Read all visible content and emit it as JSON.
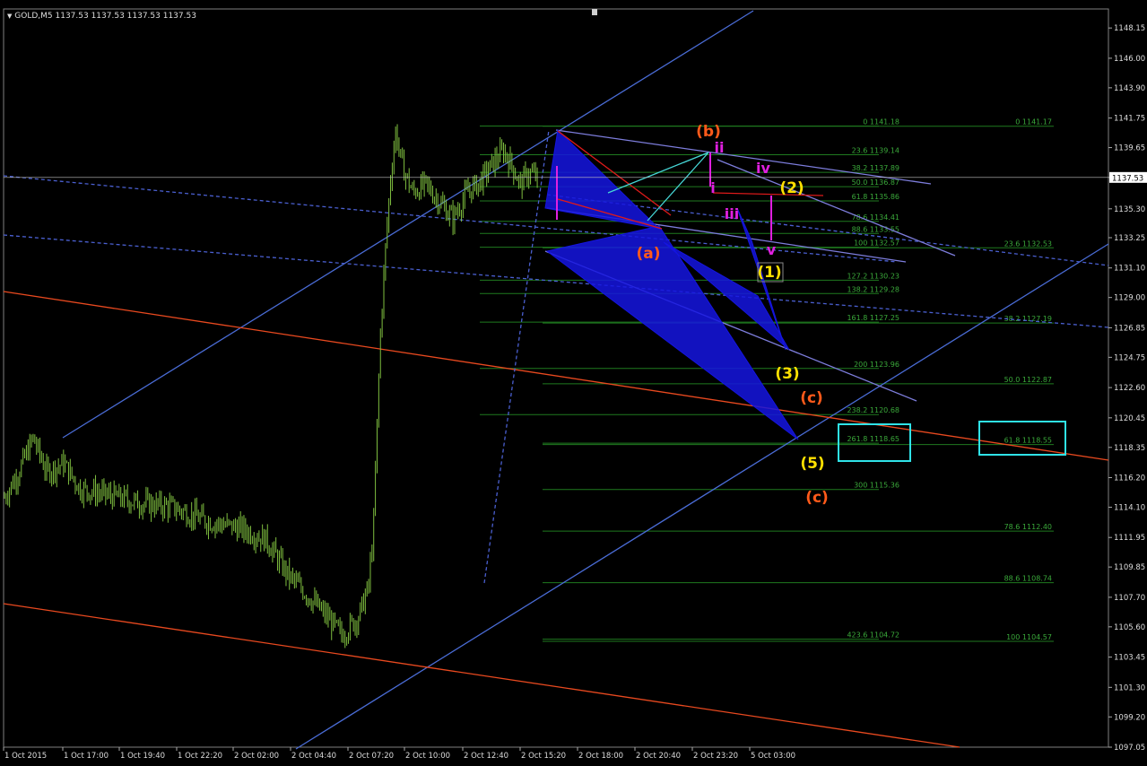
{
  "header": {
    "symbol_label": "GOLD,M5",
    "ohlc": "1137.53 1137.53 1137.53 1137.53",
    "current_price": "1137.53"
  },
  "colors": {
    "background": "#000000",
    "candles": "#7fbf3f",
    "blue_channel": "#4a6cd6",
    "red_channel": "#e8491f",
    "fibo": "#1f7a1f",
    "fibo_text": "#3aa83a",
    "orange_label": "#ff5a1a",
    "yellow_label": "#ffe000",
    "magenta_label": "#e020e0",
    "cyan_box": "#2fe3e8",
    "triangle_fill": "#1515e0",
    "price_line": "#c0c0c0"
  },
  "chart_data": {
    "type": "candlestick",
    "symbol": "GOLD",
    "timeframe": "M5",
    "ylim": [
      1097.05,
      1149.5
    ],
    "price_ticks": [
      "1148.15",
      "1146.00",
      "1143.90",
      "1141.75",
      "1139.65",
      "1137.53",
      "1135.30",
      "1133.25",
      "1131.10",
      "1129.00",
      "1126.85",
      "1124.75",
      "1122.60",
      "1120.45",
      "1118.35",
      "1116.20",
      "1114.10",
      "1111.95",
      "1109.85",
      "1107.70",
      "1105.60",
      "1103.45",
      "1101.30",
      "1099.20",
      "1097.05"
    ],
    "time_ticks": [
      "1 Oct 2015",
      "1 Oct 17:00",
      "1 Oct 19:40",
      "1 Oct 22:20",
      "2 Oct 02:00",
      "2 Oct 04:40",
      "2 Oct 07:20",
      "2 Oct 10:00",
      "2 Oct 12:40",
      "2 Oct 15:20",
      "2 Oct 18:00",
      "2 Oct 20:40",
      "2 Oct 23:20",
      "5 Oct 03:00"
    ],
    "price_path": [
      {
        "bar": 0,
        "price": 1114.8
      },
      {
        "bar": 8,
        "price": 1116.5
      },
      {
        "bar": 17,
        "price": 1119.0
      },
      {
        "bar": 25,
        "price": 1116.6
      },
      {
        "bar": 35,
        "price": 1117.2
      },
      {
        "bar": 45,
        "price": 1115.4
      },
      {
        "bar": 60,
        "price": 1115.0
      },
      {
        "bar": 80,
        "price": 1114.4
      },
      {
        "bar": 100,
        "price": 1114.1
      },
      {
        "bar": 120,
        "price": 1113.1
      },
      {
        "bar": 140,
        "price": 1112.6
      },
      {
        "bar": 155,
        "price": 1111.8
      },
      {
        "bar": 168,
        "price": 1109.3
      },
      {
        "bar": 180,
        "price": 1107.8
      },
      {
        "bar": 192,
        "price": 1106.2
      },
      {
        "bar": 200,
        "price": 1105.0
      },
      {
        "bar": 210,
        "price": 1106.3
      },
      {
        "bar": 216,
        "price": 1108.5
      },
      {
        "bar": 219,
        "price": 1113.0
      },
      {
        "bar": 221,
        "price": 1120.0
      },
      {
        "bar": 223,
        "price": 1126.5
      },
      {
        "bar": 226,
        "price": 1132.5
      },
      {
        "bar": 229,
        "price": 1137.5
      },
      {
        "bar": 232,
        "price": 1140.8
      },
      {
        "bar": 236,
        "price": 1138.3
      },
      {
        "bar": 242,
        "price": 1136.5
      },
      {
        "bar": 250,
        "price": 1137.0
      },
      {
        "bar": 258,
        "price": 1135.8
      },
      {
        "bar": 266,
        "price": 1134.6
      },
      {
        "bar": 274,
        "price": 1136.4
      },
      {
        "bar": 282,
        "price": 1137.2
      },
      {
        "bar": 290,
        "price": 1138.6
      },
      {
        "bar": 296,
        "price": 1139.4
      },
      {
        "bar": 301,
        "price": 1138.4
      },
      {
        "bar": 306,
        "price": 1137.0
      },
      {
        "bar": 311,
        "price": 1137.9
      },
      {
        "bar": 316,
        "price": 1137.53
      }
    ],
    "fibo_levels": [
      {
        "label": "0 1141.18",
        "price": 1141.18
      },
      {
        "label": "23.6 1139.14",
        "price": 1139.14
      },
      {
        "label": "38.2 1137.89",
        "price": 1137.89
      },
      {
        "label": "50.0 1136.87",
        "price": 1136.87
      },
      {
        "label": "61.8 1135.86",
        "price": 1135.86
      },
      {
        "label": "78.6 1134.41",
        "price": 1134.41
      },
      {
        "label": "88.6 1133.55",
        "price": 1133.55
      },
      {
        "label": "100 1132.57",
        "price": 1132.57
      },
      {
        "label": "127.2 1130.23",
        "price": 1130.23
      },
      {
        "label": "138.2 1129.28",
        "price": 1129.28
      },
      {
        "label": "161.8 1127.25",
        "price": 1127.25
      },
      {
        "label": "200 1123.96",
        "price": 1123.96
      },
      {
        "label": "238.2 1120.68",
        "price": 1120.68
      },
      {
        "label": "261.8 1118.65",
        "price": 1118.65
      },
      {
        "label": "300 1115.36",
        "price": 1115.36
      },
      {
        "label": "423.6 1104.72",
        "price": 1104.72
      }
    ],
    "retrace_levels": [
      {
        "label": "0 1141.17",
        "price": 1141.17
      },
      {
        "label": "23.6 1132.53",
        "price": 1132.53
      },
      {
        "label": "38.2 1127.19",
        "price": 1127.19
      },
      {
        "label": "50.0 1122.87",
        "price": 1122.87
      },
      {
        "label": "61.8 1118.55",
        "price": 1118.55
      },
      {
        "label": "78.6 1112.40",
        "price": 1112.4
      },
      {
        "label": "88.6 1108.74",
        "price": 1108.74
      },
      {
        "label": "100 1104.57",
        "price": 1104.57
      }
    ],
    "wave_labels": [
      {
        "text": "(b)",
        "group": "orange"
      },
      {
        "text": "(a)",
        "group": "orange"
      },
      {
        "text": "(c)",
        "group": "orange"
      },
      {
        "text": "(c)",
        "group": "orange"
      },
      {
        "text": "(2)",
        "group": "yellow"
      },
      {
        "text": "(1)",
        "group": "yellow"
      },
      {
        "text": "(3)",
        "group": "yellow"
      },
      {
        "text": "(5)",
        "group": "yellow"
      },
      {
        "text": "ii",
        "group": "magenta"
      },
      {
        "text": "iv",
        "group": "magenta"
      },
      {
        "text": "i",
        "group": "magenta"
      },
      {
        "text": "iii",
        "group": "magenta"
      },
      {
        "text": "v",
        "group": "magenta"
      }
    ],
    "grid": false
  }
}
